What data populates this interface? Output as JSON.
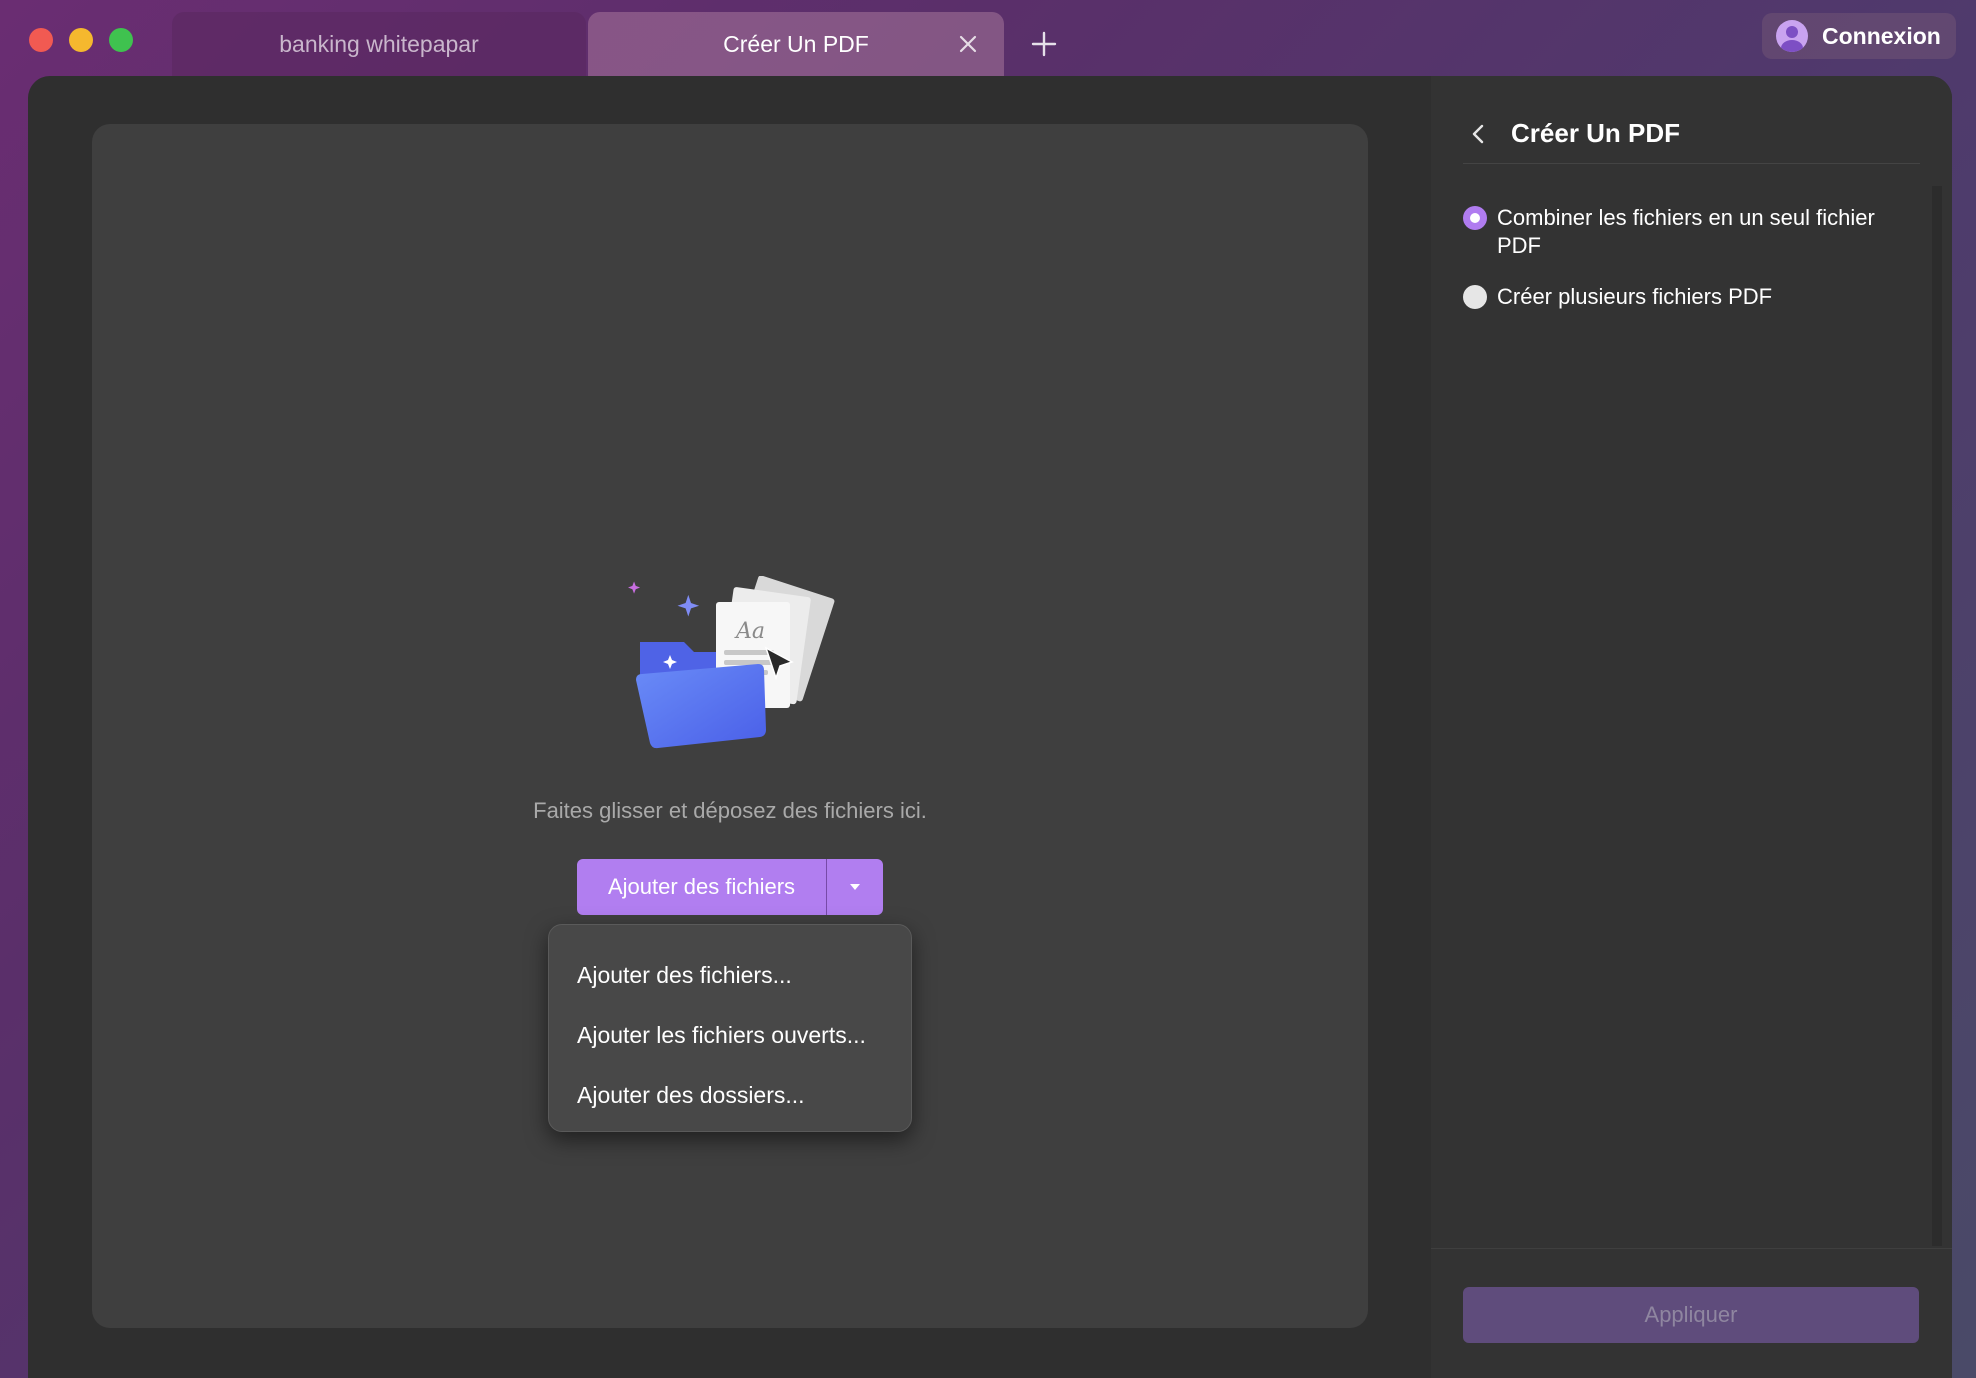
{
  "tabs": [
    {
      "label": "banking whitepapar",
      "active": false
    },
    {
      "label": "Créer Un PDF",
      "active": true
    }
  ],
  "login": {
    "label": "Connexion"
  },
  "dropzone": {
    "hint": "Faites glisser et déposez des fichiers ici.",
    "add_button_label": "Ajouter des fichiers",
    "menu": [
      "Ajouter des fichiers...",
      "Ajouter les fichiers ouverts...",
      "Ajouter des dossiers..."
    ]
  },
  "panel": {
    "title": "Créer Un PDF",
    "options": [
      {
        "label": "Combiner les fichiers en un seul fichier PDF",
        "checked": true
      },
      {
        "label": "Créer plusieurs fichiers PDF",
        "checked": false
      }
    ],
    "apply_label": "Appliquer"
  },
  "colors": {
    "accent": "#b17ef0",
    "apply_disabled": "#5f4c7c",
    "folder_blue": "#5b7cf2"
  },
  "icons": [
    "close-icon",
    "plus-icon",
    "avatar-icon",
    "chevron-left-icon",
    "chevron-down-icon",
    "folder-illustration"
  ]
}
